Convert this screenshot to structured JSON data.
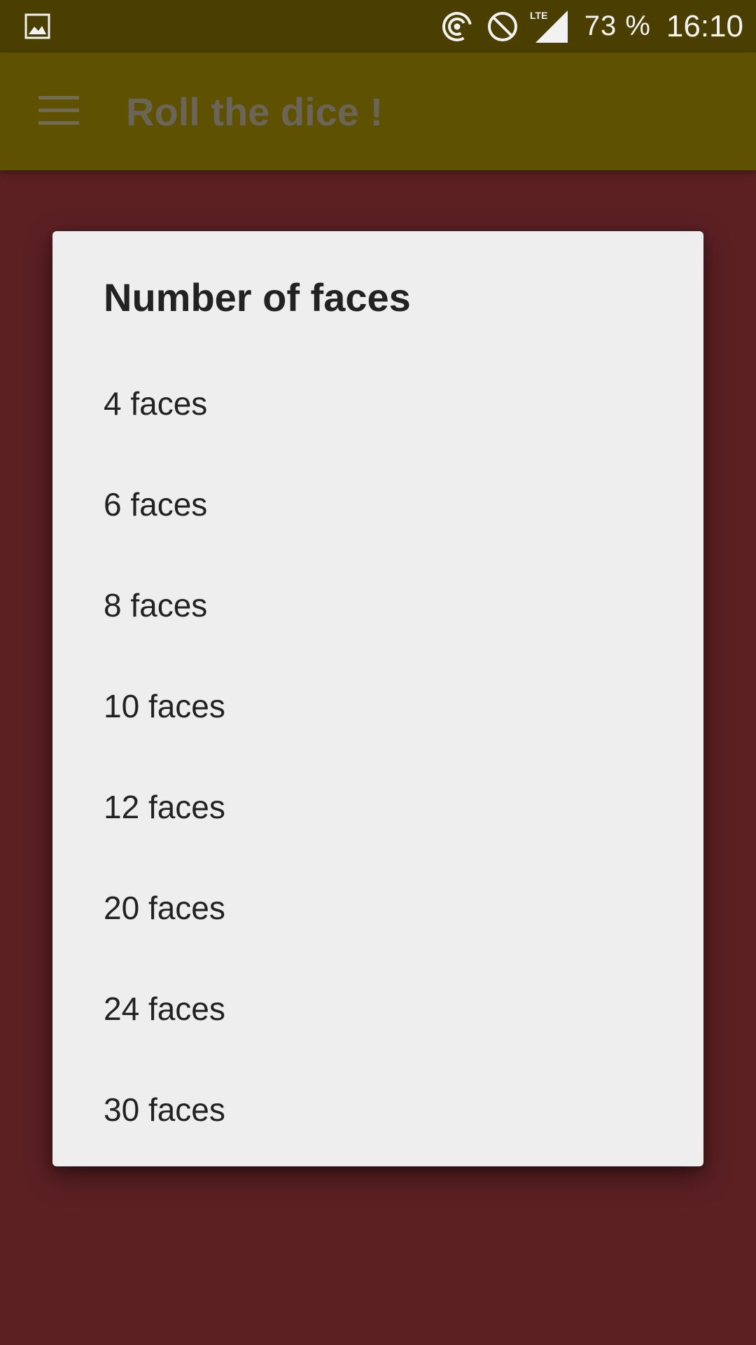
{
  "status_bar": {
    "battery": "73 %",
    "time": "16:10",
    "icons": [
      "image-icon",
      "hotspot-icon",
      "do-not-disturb-icon",
      "lte-signal-icon"
    ],
    "lte_label": "LTE"
  },
  "app_bar": {
    "title": "Roll the dice !",
    "menu_icon": "hamburger-menu-icon"
  },
  "dialog": {
    "title": "Number of faces",
    "options": [
      {
        "label": "4 faces"
      },
      {
        "label": "6 faces"
      },
      {
        "label": "8 faces"
      },
      {
        "label": "10 faces"
      },
      {
        "label": "12 faces"
      },
      {
        "label": "20 faces"
      },
      {
        "label": "24 faces"
      },
      {
        "label": "30 faces"
      }
    ]
  },
  "colors": {
    "status_bar": "#4a3f00",
    "app_bar": "#5e5102",
    "background": "#5c2023",
    "dialog": "#eeeeee"
  }
}
